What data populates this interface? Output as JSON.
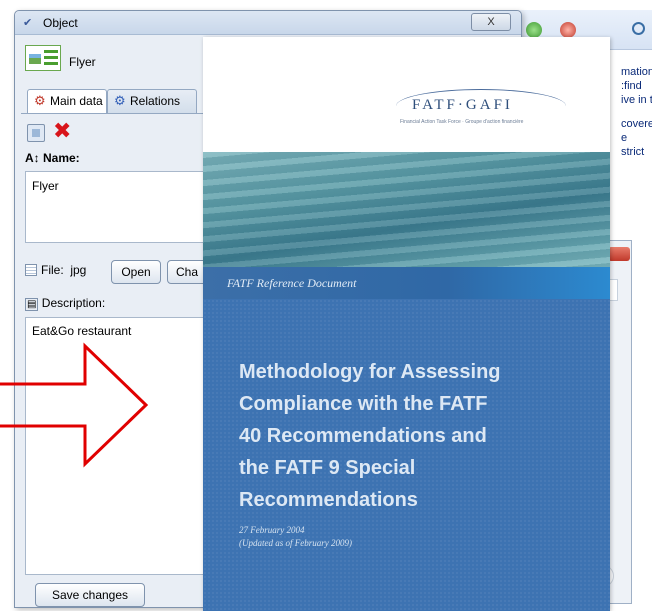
{
  "window": {
    "title": "Object",
    "close_label": "X"
  },
  "object": {
    "type_name": "Flyer"
  },
  "tabs": [
    {
      "label": "Main data",
      "icon": "main-data-icon"
    },
    {
      "label": "Relations",
      "icon": "relations-icon"
    }
  ],
  "fields": {
    "name_label": "Name:",
    "name_value": "Flyer",
    "file_label": "File:",
    "file_type": "jpg",
    "open_button": "Open",
    "change_button": "Cha",
    "description_label": "Description:",
    "description_value": "Eat&Go restaurant",
    "save_button": "Save changes"
  },
  "background_text": [
    "mation",
    ":find",
    "ive in th",
    "covered",
    "e",
    "strict"
  ],
  "document": {
    "logo": "FATF·GAFI",
    "logo_sub": "Financial Action Task Force · Groupe d'action financière",
    "ribbon": "FATF Reference Document",
    "title_lines": [
      "Methodology for Assessing",
      "Compliance with the FATF",
      "40 Recommendations and",
      "the FATF 9 Special",
      "Recommendations"
    ],
    "date_line1": "27 February 2004",
    "date_line2": "(Updated as of February 2009)"
  },
  "colors": {
    "arrow": "#e00000",
    "cover_blue": "#3d73b2",
    "delete_red": "#d8141a"
  }
}
